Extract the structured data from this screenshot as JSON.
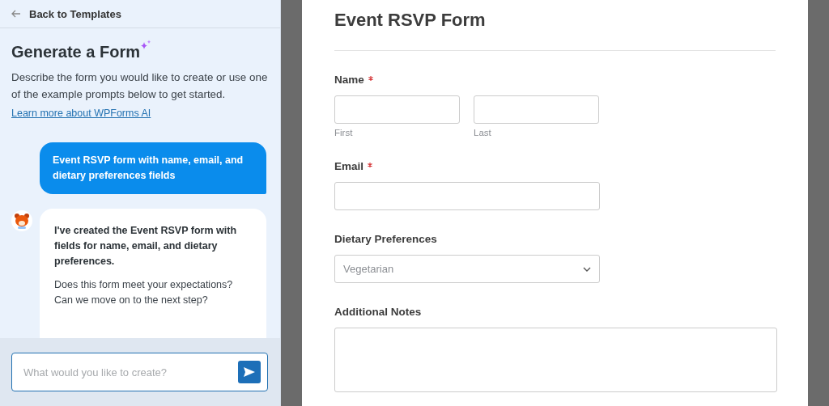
{
  "sidebar": {
    "back_link": "Back to Templates",
    "title": "Generate a Form",
    "description": "Describe the form you would like to create or use one of the example prompts below to get started.",
    "learn_link": "Learn more about WPForms AI",
    "messages": [
      {
        "kind": "user",
        "paragraphs": [
          "Event RSVP form with name, email, and dietary preferences fields"
        ]
      },
      {
        "kind": "assistant",
        "paragraphs": [
          "I've created the Event RSVP form with fields for name, email, and dietary preferences.",
          "Does this form meet your expectations? Can we move on to the next step?"
        ]
      }
    ],
    "prompt": {
      "placeholder": "What would you like to create?"
    }
  },
  "form": {
    "title": "Event RSVP Form",
    "fields": [
      {
        "kind": "name",
        "label": "Name",
        "required": true,
        "sublabels": [
          "First",
          "Last"
        ]
      },
      {
        "kind": "text",
        "label": "Email",
        "required": true
      },
      {
        "kind": "select",
        "label": "Dietary Preferences",
        "required": false,
        "value": "Vegetarian"
      },
      {
        "kind": "textarea",
        "label": "Additional Notes",
        "required": false
      }
    ]
  }
}
